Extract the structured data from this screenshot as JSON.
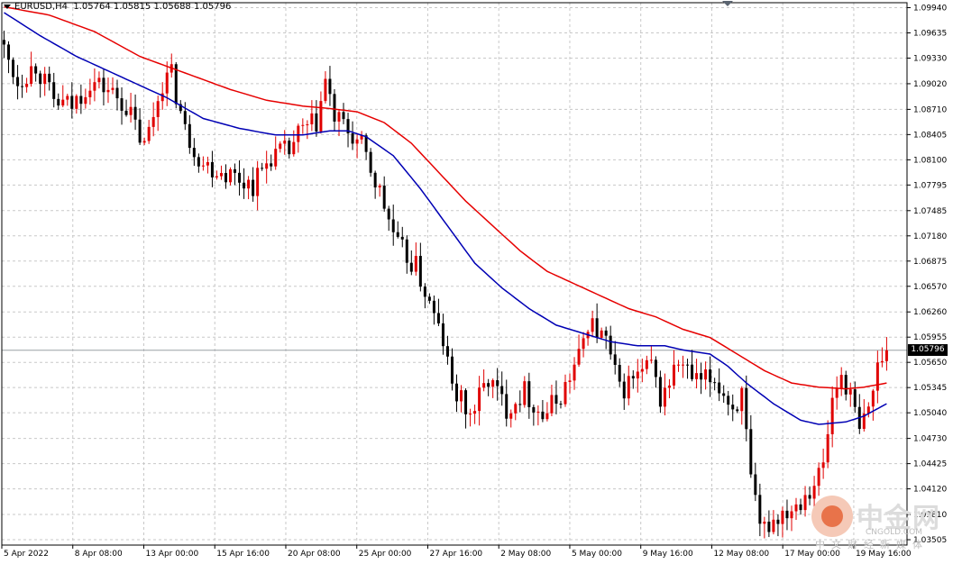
{
  "header": {
    "symbol": "EURUSD,H4",
    "ohlc": "1.05764 1.05815 1.05688 1.05796"
  },
  "current_price_label": "1.05796",
  "watermark": {
    "title": "中金网",
    "url": "CNGOLD.COM",
    "subtitle": "中文财经新媒体"
  },
  "colors": {
    "background": "#ffffff",
    "grid": "#c8c8c8",
    "bull_candle": "#e00000",
    "bear_candle": "#000000",
    "ma_fast": "#0000b4",
    "ma_slow": "#e60000",
    "price_line": "#9aa0a6"
  },
  "chart_data": {
    "type": "candlestick",
    "title": "",
    "xlabel": "",
    "ylabel": "",
    "ylim": [
      1.0344,
      1.1
    ],
    "grid": true,
    "y_ticks": [
      "1.09940",
      "1.09635",
      "1.09330",
      "1.09020",
      "1.08710",
      "1.08405",
      "1.08100",
      "1.07795",
      "1.07485",
      "1.07180",
      "1.06875",
      "1.06570",
      "1.06260",
      "1.05955",
      "1.05650",
      "1.05345",
      "1.05040",
      "1.04730",
      "1.04425",
      "1.04120",
      "1.03810",
      "1.03505"
    ],
    "x_ticks": [
      "5 Apr 2022",
      "8 Apr 08:00",
      "13 Apr 00:00",
      "15 Apr 16:00",
      "20 Apr 08:00",
      "25 Apr 00:00",
      "27 Apr 16:00",
      "2 May 08:00",
      "5 May 00:00",
      "9 May 16:00",
      "12 May 08:00",
      "17 May 00:00",
      "19 May 16:00"
    ],
    "current_price": 1.05796,
    "anchors": [
      [
        0,
        1.0955
      ],
      [
        4,
        1.0905
      ],
      [
        8,
        1.0925
      ],
      [
        12,
        1.088
      ],
      [
        16,
        1.0875
      ],
      [
        20,
        1.0905
      ],
      [
        24,
        1.0895
      ],
      [
        28,
        1.0875
      ],
      [
        32,
        1.0825
      ],
      [
        36,
        1.0905
      ],
      [
        38,
        1.0912
      ],
      [
        41,
        1.0845
      ],
      [
        45,
        1.0805
      ],
      [
        50,
        1.0795
      ],
      [
        56,
        1.078
      ],
      [
        60,
        1.0815
      ],
      [
        64,
        1.082
      ],
      [
        66,
        1.084
      ],
      [
        70,
        1.0855
      ],
      [
        72,
        1.0905
      ],
      [
        74,
        1.086
      ],
      [
        76,
        1.085
      ],
      [
        80,
        1.0825
      ],
      [
        84,
        1.077
      ],
      [
        88,
        1.0705
      ],
      [
        92,
        1.068
      ],
      [
        96,
        1.062
      ],
      [
        98,
        1.059
      ],
      [
        100,
        1.0535
      ],
      [
        104,
        1.05
      ],
      [
        108,
        1.0545
      ],
      [
        112,
        1.051
      ],
      [
        116,
        1.053
      ],
      [
        120,
        1.05
      ],
      [
        124,
        1.0525
      ],
      [
        128,
        1.057
      ],
      [
        130,
        1.0615
      ],
      [
        134,
        1.059
      ],
      [
        137,
        1.053
      ],
      [
        140,
        1.0545
      ],
      [
        144,
        1.056
      ],
      [
        146,
        1.052
      ],
      [
        150,
        1.0565
      ],
      [
        154,
        1.054
      ],
      [
        158,
        1.0545
      ],
      [
        162,
        1.051
      ],
      [
        164,
        1.0525
      ],
      [
        166,
        1.042
      ],
      [
        168,
        1.036
      ],
      [
        172,
        1.038
      ],
      [
        176,
        1.0395
      ],
      [
        180,
        1.042
      ],
      [
        182,
        1.044
      ],
      [
        184,
        1.052
      ],
      [
        186,
        1.055
      ],
      [
        188,
        1.0525
      ],
      [
        190,
        1.048
      ],
      [
        192,
        1.051
      ],
      [
        195,
        1.058
      ]
    ],
    "ma_fast": {
      "name": "",
      "points": [
        [
          0,
          1.0988
        ],
        [
          8,
          1.096
        ],
        [
          16,
          1.0935
        ],
        [
          24,
          1.0915
        ],
        [
          30,
          1.09
        ],
        [
          36,
          1.0885
        ],
        [
          44,
          1.086
        ],
        [
          52,
          1.0848
        ],
        [
          60,
          1.084
        ],
        [
          66,
          1.084
        ],
        [
          72,
          1.0845
        ],
        [
          76,
          1.0845
        ],
        [
          80,
          1.0838
        ],
        [
          86,
          1.0815
        ],
        [
          92,
          1.0775
        ],
        [
          98,
          1.073
        ],
        [
          104,
          1.0685
        ],
        [
          110,
          1.0655
        ],
        [
          116,
          1.063
        ],
        [
          122,
          1.061
        ],
        [
          128,
          1.06
        ],
        [
          134,
          1.059
        ],
        [
          140,
          1.0585
        ],
        [
          146,
          1.0585
        ],
        [
          150,
          1.058
        ],
        [
          156,
          1.0575
        ],
        [
          160,
          1.056
        ],
        [
          164,
          1.054
        ],
        [
          170,
          1.0515
        ],
        [
          176,
          1.0495
        ],
        [
          180,
          1.049
        ],
        [
          186,
          1.0493
        ],
        [
          190,
          1.05
        ],
        [
          195,
          1.0515
        ]
      ]
    },
    "ma_slow": {
      "name": "",
      "points": [
        [
          0,
          1.0995
        ],
        [
          10,
          1.0985
        ],
        [
          20,
          1.0965
        ],
        [
          30,
          1.0935
        ],
        [
          40,
          1.0915
        ],
        [
          50,
          1.0895
        ],
        [
          58,
          1.0882
        ],
        [
          66,
          1.0875
        ],
        [
          72,
          1.0872
        ],
        [
          78,
          1.0868
        ],
        [
          84,
          1.0855
        ],
        [
          90,
          1.083
        ],
        [
          96,
          1.0795
        ],
        [
          102,
          1.076
        ],
        [
          108,
          1.073
        ],
        [
          114,
          1.07
        ],
        [
          120,
          1.0675
        ],
        [
          126,
          1.066
        ],
        [
          132,
          1.0645
        ],
        [
          138,
          1.063
        ],
        [
          144,
          1.062
        ],
        [
          150,
          1.0605
        ],
        [
          156,
          1.0595
        ],
        [
          162,
          1.0575
        ],
        [
          168,
          1.0555
        ],
        [
          174,
          1.054
        ],
        [
          180,
          1.0535
        ],
        [
          186,
          1.0533
        ],
        [
          190,
          1.0535
        ],
        [
          195,
          1.054
        ]
      ]
    }
  }
}
